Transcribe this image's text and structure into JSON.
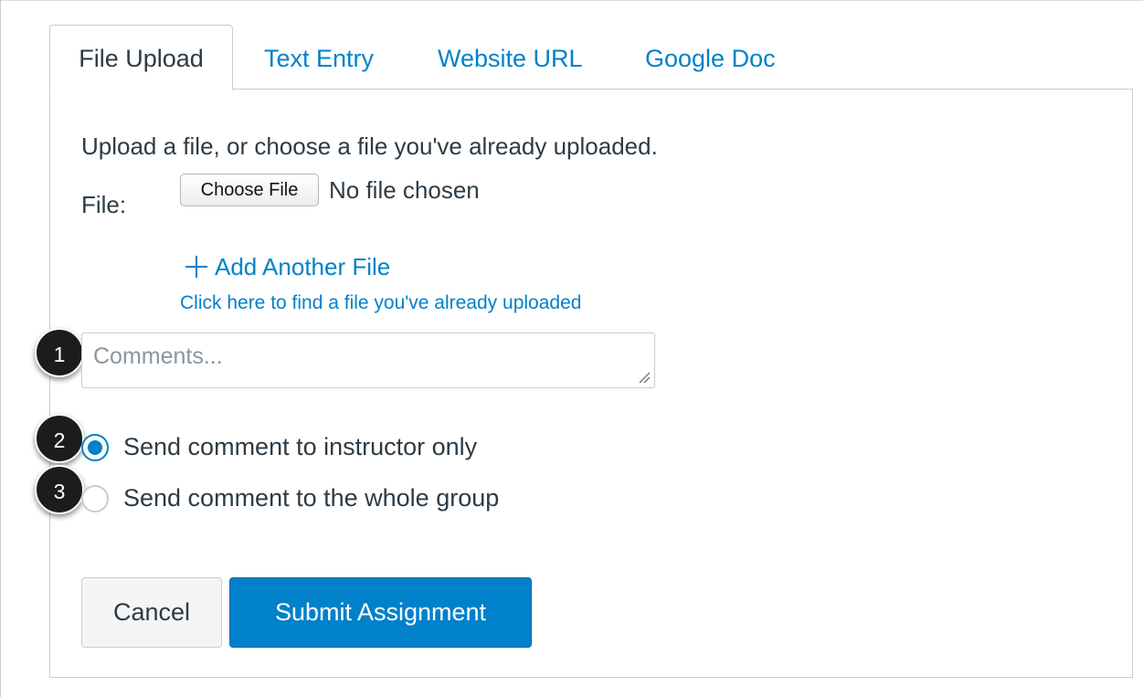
{
  "tabs": [
    {
      "label": "File Upload",
      "active": true
    },
    {
      "label": "Text Entry",
      "active": false
    },
    {
      "label": "Website URL",
      "active": false
    },
    {
      "label": "Google Doc",
      "active": false
    }
  ],
  "upload": {
    "intro": "Upload a file, or choose a file you've already uploaded.",
    "file_label": "File:",
    "choose_button": "Choose File",
    "no_file_text": "No file chosen",
    "add_another": "Add Another File",
    "find_link": "Click here to find a file you've already uploaded"
  },
  "comments": {
    "placeholder": "Comments...",
    "value": ""
  },
  "callouts": [
    "1",
    "2",
    "3"
  ],
  "recipients": [
    {
      "label": "Send comment to instructor only",
      "checked": true
    },
    {
      "label": "Send comment to the whole group",
      "checked": false
    }
  ],
  "actions": {
    "cancel": "Cancel",
    "submit": "Submit Assignment"
  },
  "colors": {
    "accent": "#0081c9",
    "text": "#2d3b45",
    "border": "#c7cdd1",
    "badge": "#1c1c1c"
  },
  "icons": [
    "plus-icon",
    "resize-grip-icon"
  ]
}
